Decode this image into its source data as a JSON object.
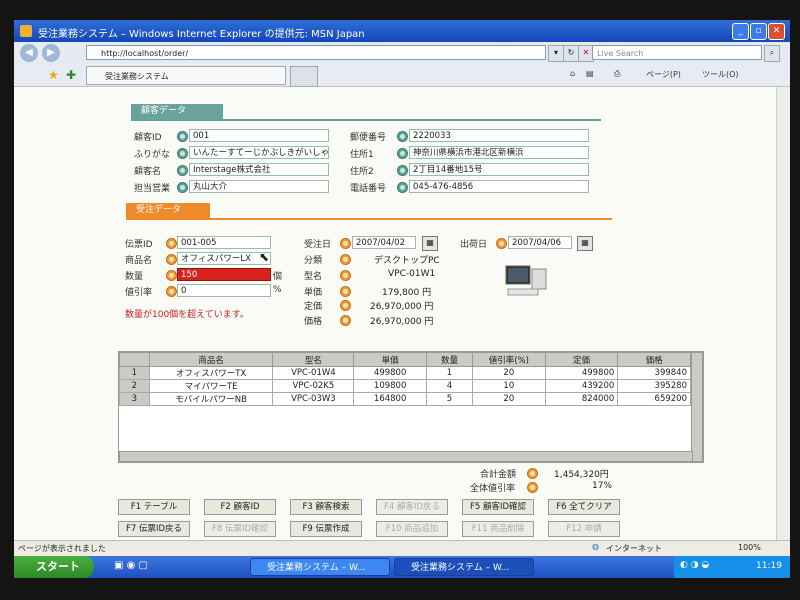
{
  "window": {
    "title": "受注業務システム – Windows Internet Explorer の提供元: MSN Japan",
    "url": "http://localhost/order/",
    "search_placeholder": "Live Search",
    "tab_label": "受注業務システム",
    "tools_page": "ページ(P)",
    "tools_tool": "ツール(O)"
  },
  "customer": {
    "header": "顧客データ",
    "fields": [
      {
        "label": "顧客ID",
        "value": "001"
      },
      {
        "label": "ふりがな",
        "value": "いんたーすてーじかぶしきがいしゃ"
      },
      {
        "label": "顧客名",
        "value": "Interstage株式会社"
      },
      {
        "label": "担当営業",
        "value": "丸山大介"
      },
      {
        "label": "郵便番号",
        "value": "2220033"
      },
      {
        "label": "住所1",
        "value": "神奈川県横浜市港北区新横浜"
      },
      {
        "label": "住所2",
        "value": "2丁目14番地15号"
      },
      {
        "label": "電話番号",
        "value": "045-476-4856"
      }
    ]
  },
  "order": {
    "header": "受注データ",
    "slip_id_label": "伝票ID",
    "slip_id": "001-005",
    "product_label": "商品名",
    "product": "オフィスパワーLX",
    "qty_label": "数量",
    "qty": "150",
    "qty_unit": "個",
    "discount_label": "値引率",
    "discount": "0",
    "discount_unit": "%",
    "order_date_label": "受注日",
    "order_date": "2007/04/02",
    "ship_date_label": "出荷日",
    "ship_date": "2007/04/06",
    "category_label": "分類",
    "category": "デスクトップPC",
    "model_label": "型名",
    "model": "VPC-01W1",
    "unit_price_label": "単価",
    "unit_price": "179,800 円",
    "list_price_label": "定価",
    "list_price": "26,970,000 円",
    "price_label": "価格",
    "price": "26,970,000 円",
    "error": "数量が100個を超えています。"
  },
  "table": {
    "headers": [
      "",
      "商品名",
      "型名",
      "単価",
      "数量",
      "値引率(%)",
      "定価",
      "価格"
    ],
    "rows": [
      [
        "1",
        "オフィスパワーTX",
        "VPC-01W4",
        "499800",
        "1",
        "20",
        "499800",
        "399840"
      ],
      [
        "2",
        "マイパワーTE",
        "VPC-02K5",
        "109800",
        "4",
        "10",
        "439200",
        "395280"
      ],
      [
        "3",
        "モバイルパワーNB",
        "VPC-03W3",
        "164800",
        "5",
        "20",
        "824000",
        "659200"
      ]
    ]
  },
  "totals": {
    "total_label": "合計金額",
    "total": "1,454,320円",
    "discount_label": "全体値引率",
    "discount": "17%"
  },
  "fkeys": [
    {
      "label": "F1 テーブル",
      "enabled": true
    },
    {
      "label": "F2 顧客ID",
      "enabled": true
    },
    {
      "label": "F3 顧客検索",
      "enabled": true
    },
    {
      "label": "F4 顧客ID戻る",
      "enabled": false
    },
    {
      "label": "F5 顧客ID確認",
      "enabled": true
    },
    {
      "label": "F6 全てクリア",
      "enabled": true
    },
    {
      "label": "F7 伝票ID戻る",
      "enabled": true
    },
    {
      "label": "F8 伝票ID確認",
      "enabled": false
    },
    {
      "label": "F9 伝票作成",
      "enabled": true
    },
    {
      "label": "F10 商品追加",
      "enabled": false
    },
    {
      "label": "F11 商品削除",
      "enabled": false
    },
    {
      "label": "F12 申請",
      "enabled": false
    }
  ],
  "status": {
    "text": "ページが表示されました",
    "zone": "インターネット",
    "zoom": "100%"
  },
  "taskbar": {
    "start": "スタート",
    "items": [
      "受注業務システム – W...",
      "受注業務システム – W..."
    ],
    "clock": "11:19"
  },
  "colors": {
    "customer_accent": "#6aa39b",
    "order_accent": "#ef8a2a",
    "error": "#c62020",
    "qty_highlight": "#d8241c"
  }
}
